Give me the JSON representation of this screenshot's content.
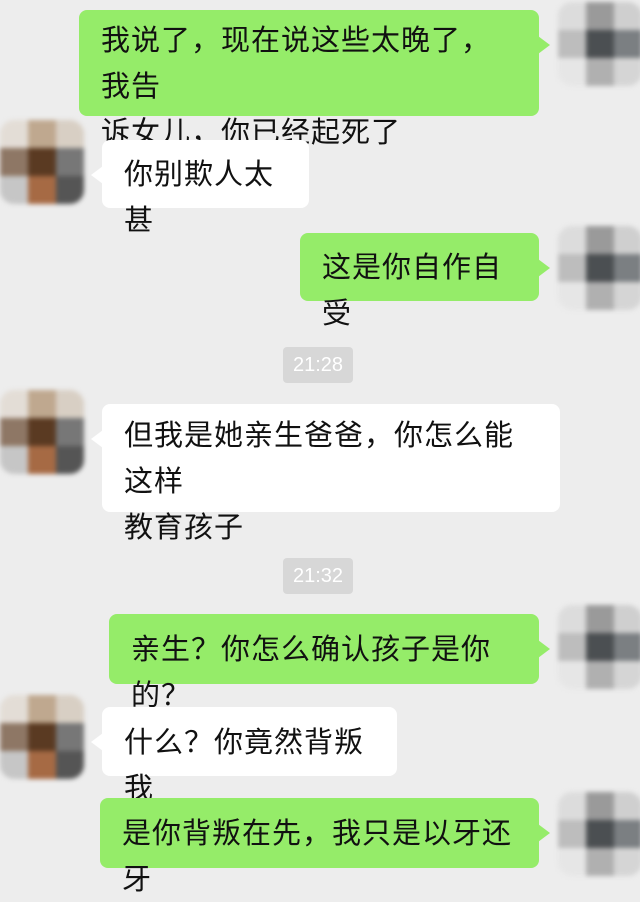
{
  "chat": {
    "messages": [
      {
        "side": "right",
        "lines": [
          "我说了，现在说这些太晚了，我告",
          "诉女儿，你已经起死了"
        ]
      },
      {
        "side": "left",
        "lines": [
          "你别欺人太甚"
        ]
      },
      {
        "side": "right",
        "lines": [
          "这是你自作自受"
        ]
      },
      {
        "side": "left",
        "lines": [
          "但我是她亲生爸爸，你怎么能这样",
          "教育孩子"
        ]
      },
      {
        "side": "right",
        "lines": [
          "亲生？你怎么确认孩子是你的？"
        ]
      },
      {
        "side": "left",
        "lines": [
          "什么？你竟然背叛我"
        ]
      },
      {
        "side": "right",
        "lines": [
          "是你背叛在先，我只是以牙还牙"
        ]
      }
    ],
    "timestamps": [
      "21:28",
      "21:32"
    ]
  },
  "colors": {
    "background": "#ededed",
    "outgoing_bubble": "#95ec69",
    "incoming_bubble": "#ffffff",
    "timestamp_bg": "#d7d7d7"
  }
}
